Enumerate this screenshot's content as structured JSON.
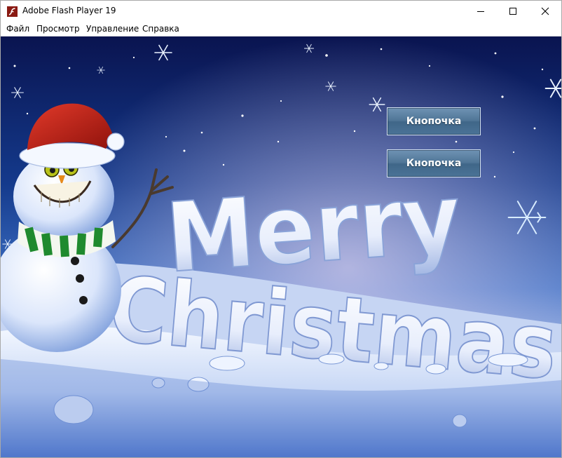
{
  "window": {
    "title": "Adobe Flash Player 19"
  },
  "menu": {
    "items": [
      {
        "label": "Файл"
      },
      {
        "label": "Просмотр"
      },
      {
        "label": "Управление"
      },
      {
        "label": "Справка"
      }
    ]
  },
  "stage": {
    "buttons": [
      {
        "label": "Кнопочка"
      },
      {
        "label": "Кнопочка"
      }
    ],
    "greeting_line1": "Merry",
    "greeting_line2": "Christmas"
  },
  "colors": {
    "sky_top": "#0b1a5c",
    "sky_mid": "#1f4fa8",
    "horizon": "#b9c9ee",
    "snow": "#eef4ff",
    "button_fill": "#4f7596",
    "hat_red": "#c21d16",
    "scarf_green": "#1f8a2e"
  }
}
